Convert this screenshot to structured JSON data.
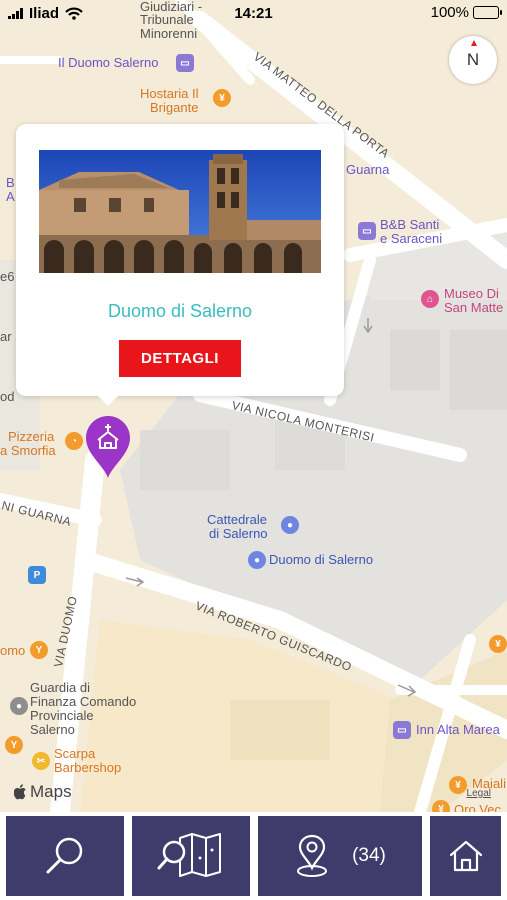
{
  "status_bar": {
    "carrier": "Iliad",
    "time": "14:21",
    "battery": "100%"
  },
  "map": {
    "compass_label": "N",
    "apple_maps": "Maps",
    "legal": "Legal",
    "streets": {
      "via_matteo": "VIA MATTEO DELLA PORTA",
      "via_nicola": "VIA NICOLA MONTERISI",
      "via_roberto": "VIA ROBERTO GUISCARDO",
      "via_duomo": "VIA DUOMO",
      "via_guarna": "NI GUARNA"
    },
    "labels": {
      "giudiziari": "Giudiziari -",
      "tribunale": "Tribunale",
      "minorenni": "Minorenni",
      "duomo_salerno_hotel": "Il Duomo Salerno",
      "hostaria_1": "Hostaria Il",
      "hostaria_2": "Brigante",
      "guarna": "Guarna",
      "bb_1": "B&B Santi",
      "bb_2": "e Saraceni",
      "museo_1": "Museo Di",
      "museo_2": "San Matte",
      "pizzeria_1": "Pizzeria",
      "pizzeria_2": "a Smorfia",
      "cattedrale_1": "Cattedrale",
      "cattedrale_2": "di Salerno",
      "duomo_poi": "Duomo di Salerno",
      "guardia_1": "Guardia di",
      "guardia_2": "Finanza Comando",
      "guardia_3": "Provinciale",
      "guardia_4": "Salerno",
      "scarpa_1": "Scarpa",
      "scarpa_2": "Barbershop",
      "inn": "Inn Alta Marea",
      "maiali": "Maiali",
      "oro": "Oro Vec",
      "left_e6": "e6",
      "left_ar": "ar",
      "left_od": "od",
      "left_omo": "omo",
      "left_b": "B",
      "left_a": "A"
    }
  },
  "callout": {
    "title": "Duomo di Salerno",
    "button_label": "DETTAGLI"
  },
  "toolbar": {
    "count": "(34)"
  },
  "colors": {
    "toolbar_bg": "#3f3c6c",
    "accent_teal": "#37bdbf",
    "button_red": "#e8161b",
    "pin_purple": "#9b35c7"
  }
}
